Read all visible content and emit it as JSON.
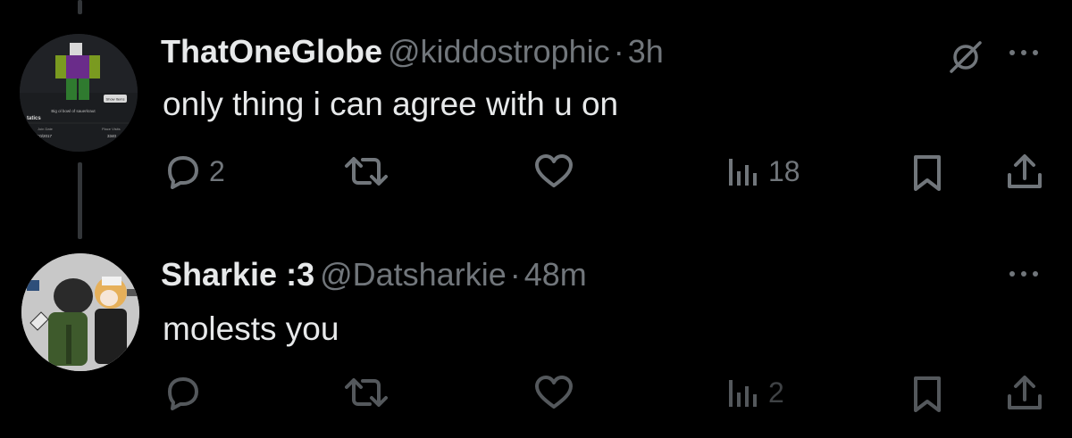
{
  "tweets": [
    {
      "display_name": "ThatOneGlobe",
      "handle": "@kiddostrophic",
      "separator": "·",
      "time": "3h",
      "text": "only thing i can agree with u on",
      "replies": "2",
      "retweets": "",
      "likes": "",
      "views": "18",
      "avatar_text": {
        "button": "Show Items",
        "caption": "Big ol bowl of sauerkraut",
        "stats": "tatics",
        "join_label": "Join Date",
        "join_value": "1/10/2017",
        "visits_label": "Place Visits",
        "visits_value": "3340"
      }
    },
    {
      "display_name": "Sharkie :3",
      "handle": "@Datsharkie",
      "separator": "·",
      "time": "48m",
      "text": "molests you",
      "replies": "",
      "retweets": "",
      "likes": "",
      "views": "2"
    }
  ],
  "colors": {
    "background": "#000000",
    "text_primary": "#e7e9ea",
    "text_secondary": "#71767b",
    "thread_line": "#333639"
  },
  "icons": [
    "reply-icon",
    "retweet-icon",
    "like-icon",
    "views-icon",
    "bookmark-icon",
    "share-icon",
    "grok-icon",
    "more-icon"
  ]
}
